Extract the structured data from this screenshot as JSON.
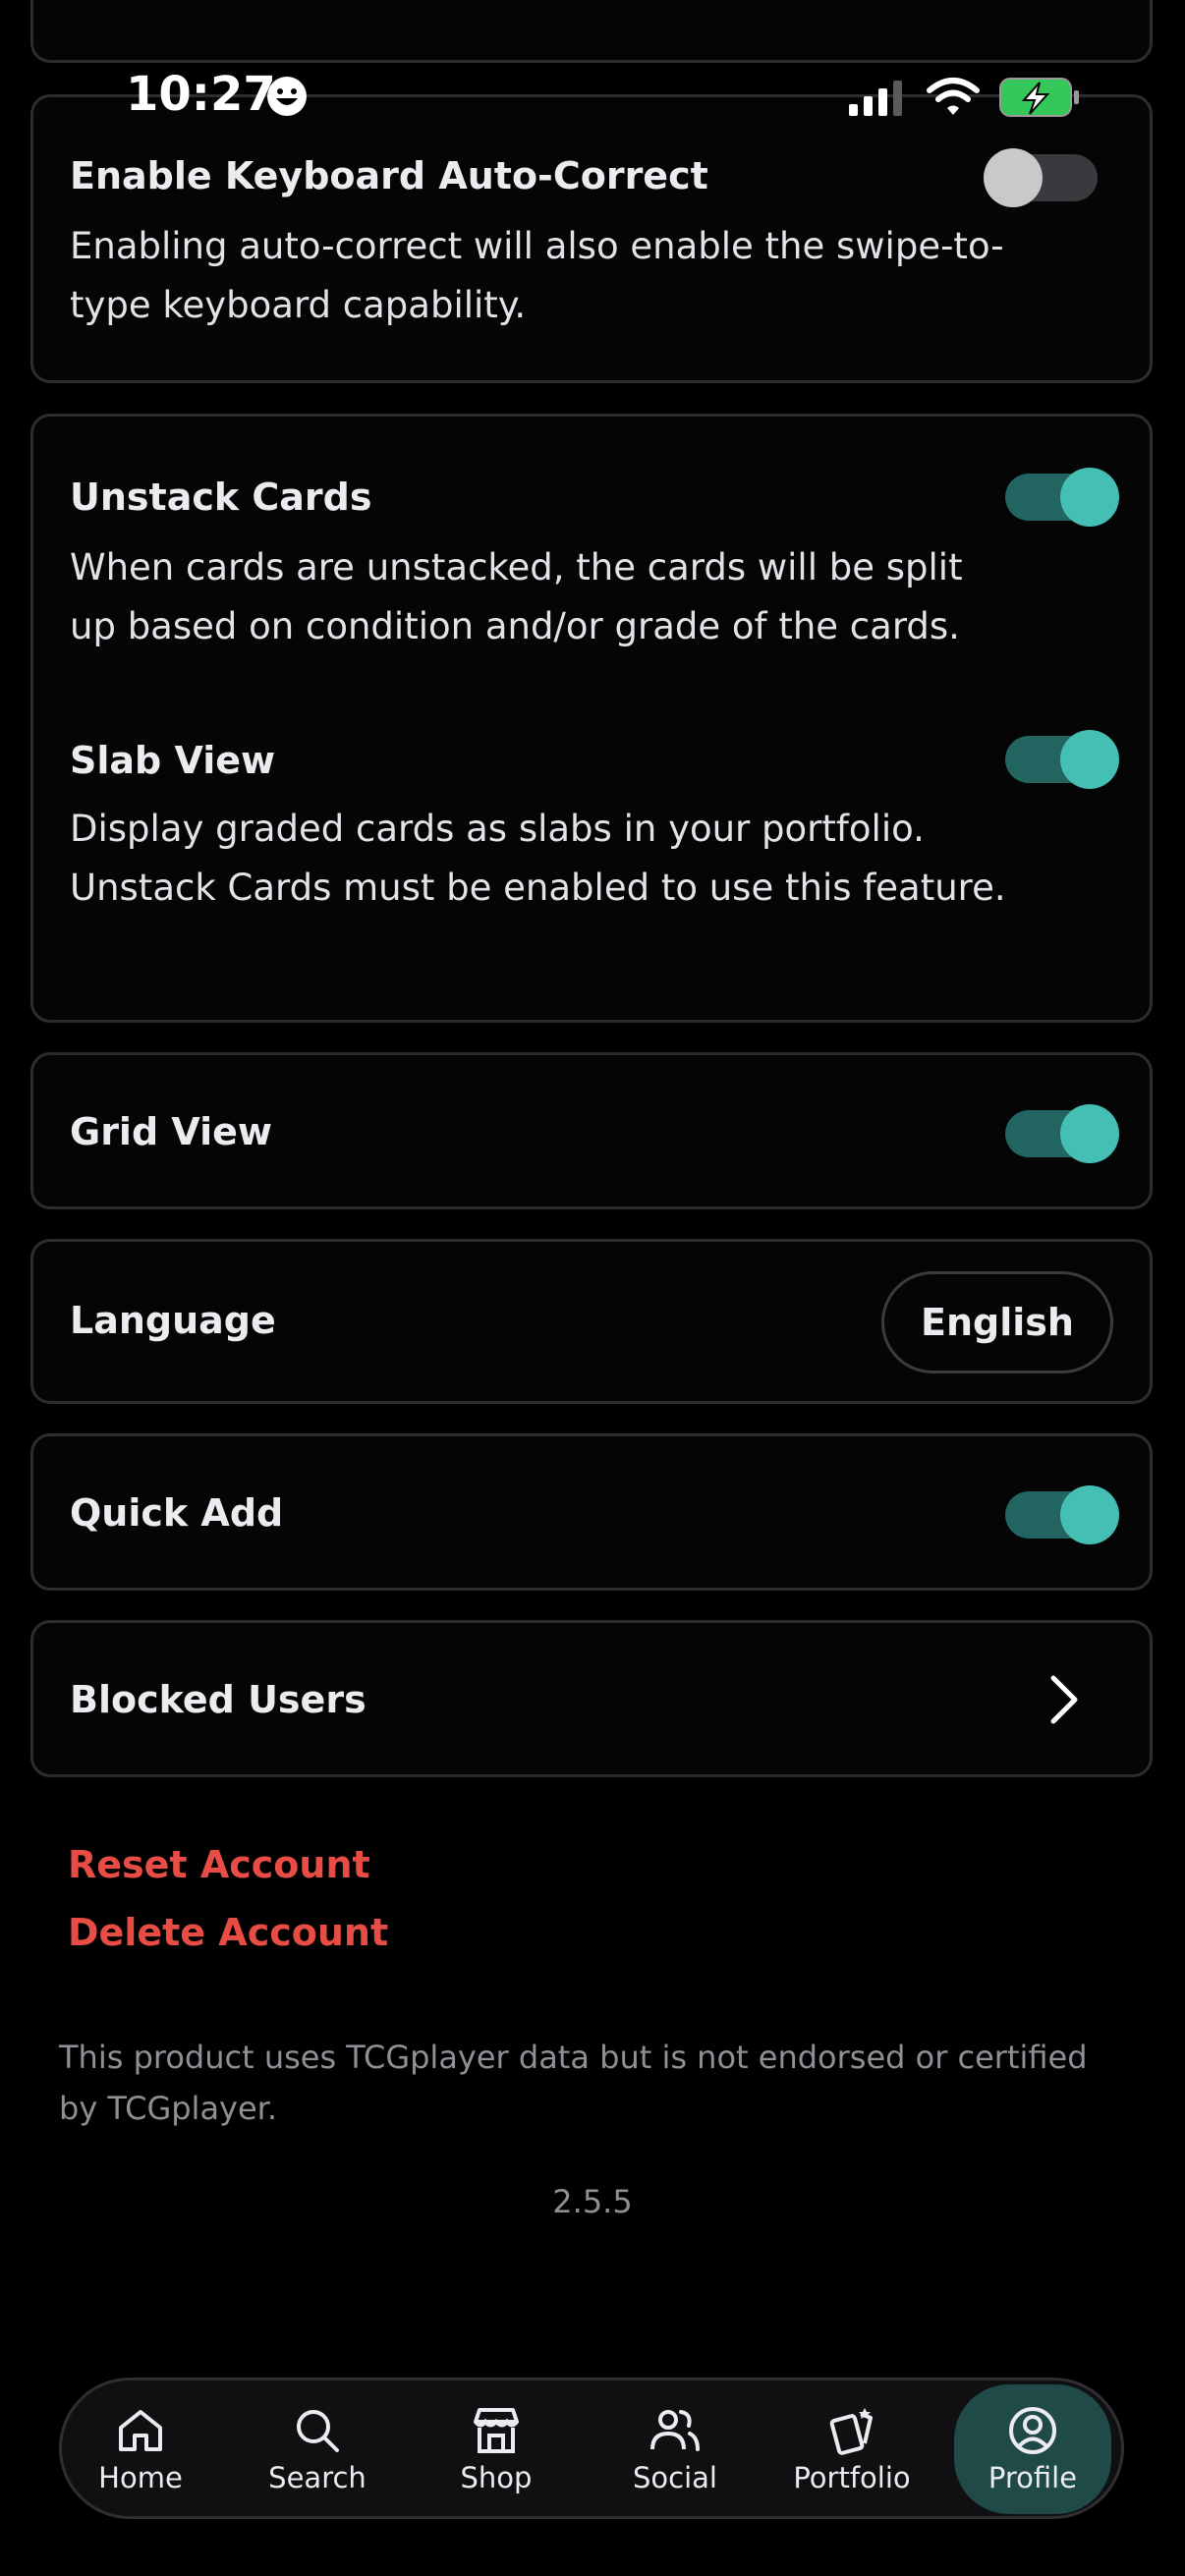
{
  "status_bar": {
    "time": "10:27"
  },
  "settings": {
    "autocorrect": {
      "title": "Enable Keyboard Auto-Correct",
      "description": "Enabling auto-correct will also enable the swipe-to-type keyboard capability.",
      "enabled": false
    },
    "unstack_cards": {
      "title": "Unstack Cards",
      "description": "When cards are unstacked, the cards will be split up based on condition and/or grade of the cards.",
      "enabled": true
    },
    "slab_view": {
      "title": "Slab View",
      "description": "Display graded cards as slabs in your portfolio. Unstack Cards must be enabled to use this feature.",
      "enabled": true
    },
    "grid_view": {
      "title": "Grid View",
      "enabled": true
    },
    "language": {
      "title": "Language",
      "value": "English"
    },
    "quick_add": {
      "title": "Quick Add",
      "enabled": true
    },
    "blocked_users": {
      "title": "Blocked Users"
    }
  },
  "account_actions": {
    "reset": "Reset Account",
    "delete": "Delete Account"
  },
  "footer": {
    "disclaimer": "This product uses TCGplayer data but is not endorsed or certified by TCGplayer.",
    "version": "2.5.5"
  },
  "tab_bar": {
    "items": [
      {
        "label": "Home",
        "icon": "home-icon"
      },
      {
        "label": "Search",
        "icon": "search-icon"
      },
      {
        "label": "Shop",
        "icon": "shop-icon"
      },
      {
        "label": "Social",
        "icon": "social-icon"
      },
      {
        "label": "Portfolio",
        "icon": "portfolio-icon"
      },
      {
        "label": "Profile",
        "icon": "profile-icon"
      }
    ],
    "active": "Profile"
  },
  "colors": {
    "accent": "#45bfb4",
    "accent_track": "#226560",
    "danger": "#e84d45",
    "background": "#000000"
  }
}
